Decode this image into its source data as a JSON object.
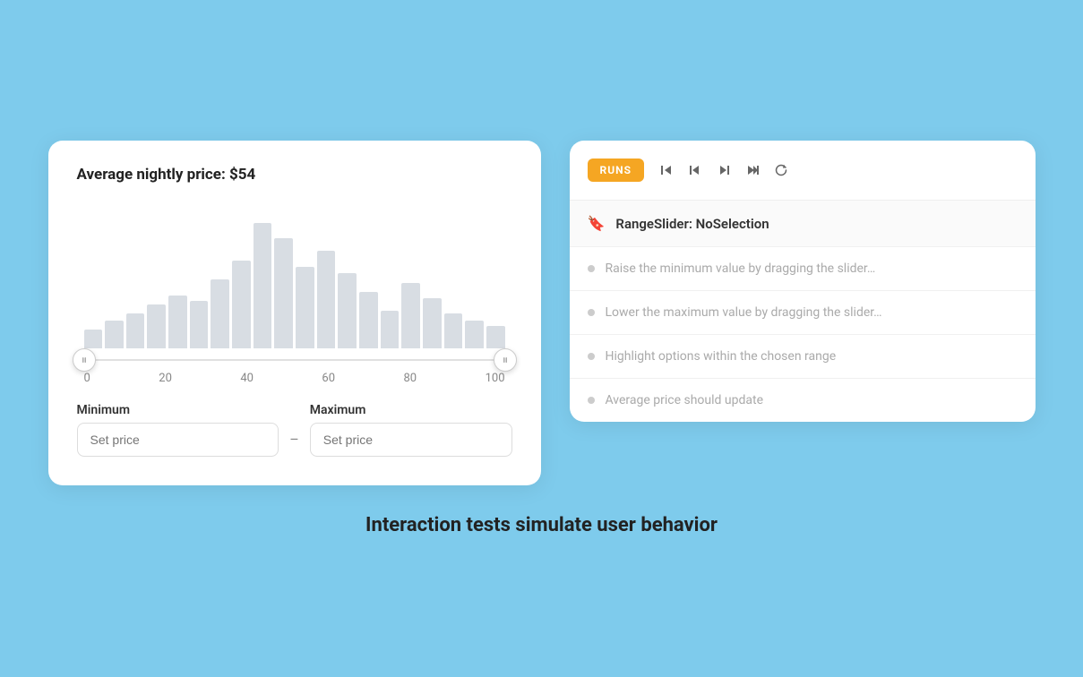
{
  "page": {
    "background": "#7ecbec"
  },
  "left_card": {
    "price_label": "Average nightly price: ",
    "price_value": "$54",
    "slider_min": 0,
    "slider_max": 100,
    "axis_labels": [
      "0",
      "20",
      "40",
      "60",
      "80",
      "100"
    ],
    "minimum_label": "Minimum",
    "maximum_label": "Maximum",
    "min_placeholder": "Set price",
    "max_placeholder": "Set price",
    "dash": "–",
    "bars": [
      15,
      22,
      28,
      35,
      42,
      38,
      55,
      70,
      100,
      88,
      65,
      78,
      60,
      45,
      30,
      52,
      40,
      28,
      22,
      18
    ]
  },
  "right_card": {
    "runs_label": "RUNS",
    "test_name": "RangeSlider: NoSelection",
    "steps": [
      "Raise the minimum value by dragging the slider…",
      "Lower the maximum value by dragging the slider…",
      "Highlight options within the chosen range",
      "Average price should update"
    ],
    "controls": [
      {
        "name": "skip-back",
        "symbol": "⏮"
      },
      {
        "name": "step-back",
        "symbol": "⏭"
      },
      {
        "name": "step-forward",
        "symbol": "⏭"
      },
      {
        "name": "skip-forward",
        "symbol": "⏭"
      },
      {
        "name": "refresh",
        "symbol": "↻"
      }
    ]
  },
  "footer": {
    "text": "Interaction tests simulate user behavior"
  }
}
